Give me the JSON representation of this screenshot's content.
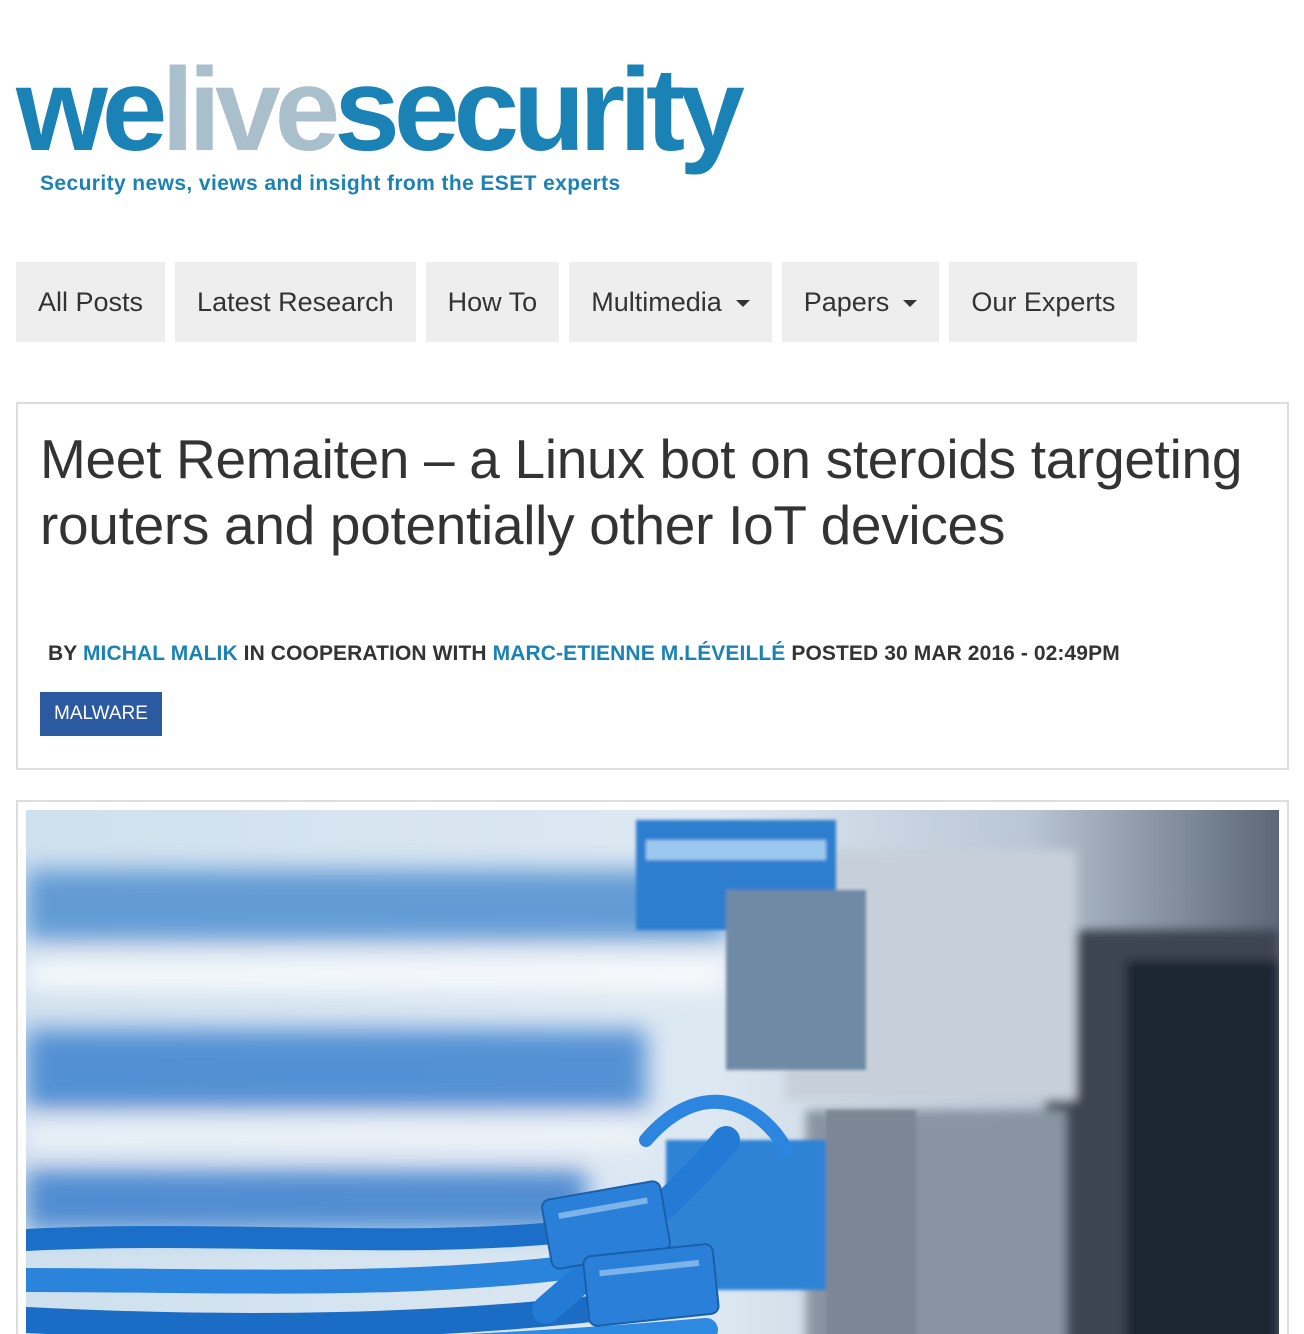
{
  "logo": {
    "we": "we",
    "live": "live",
    "security": "security",
    "tagline": "Security news, views and insight from the ESET experts",
    "colors": {
      "primary": "#1a82b4",
      "secondary": "#a9bfcc"
    }
  },
  "nav": {
    "items": [
      {
        "label": "All Posts",
        "dropdown": false
      },
      {
        "label": "Latest Research",
        "dropdown": false
      },
      {
        "label": "How To",
        "dropdown": false
      },
      {
        "label": "Multimedia",
        "dropdown": true
      },
      {
        "label": "Papers",
        "dropdown": true
      },
      {
        "label": "Our Experts",
        "dropdown": false
      }
    ]
  },
  "article": {
    "title": "Meet Remaiten – a Linux bot on steroids targeting routers and potentially other IoT devices",
    "byline": {
      "by": "BY",
      "author1": "MICHAL MALIK",
      "cooperation": "IN COOPERATION WITH",
      "author2": "MARC-ETIENNE M.LÉVEILLÉ",
      "posted": "POSTED 30 MAR 2016 - 02:49PM"
    },
    "tag": "MALWARE",
    "tag_color": "#2c5aa0",
    "hero_image": "blue-network-cables-photo"
  }
}
